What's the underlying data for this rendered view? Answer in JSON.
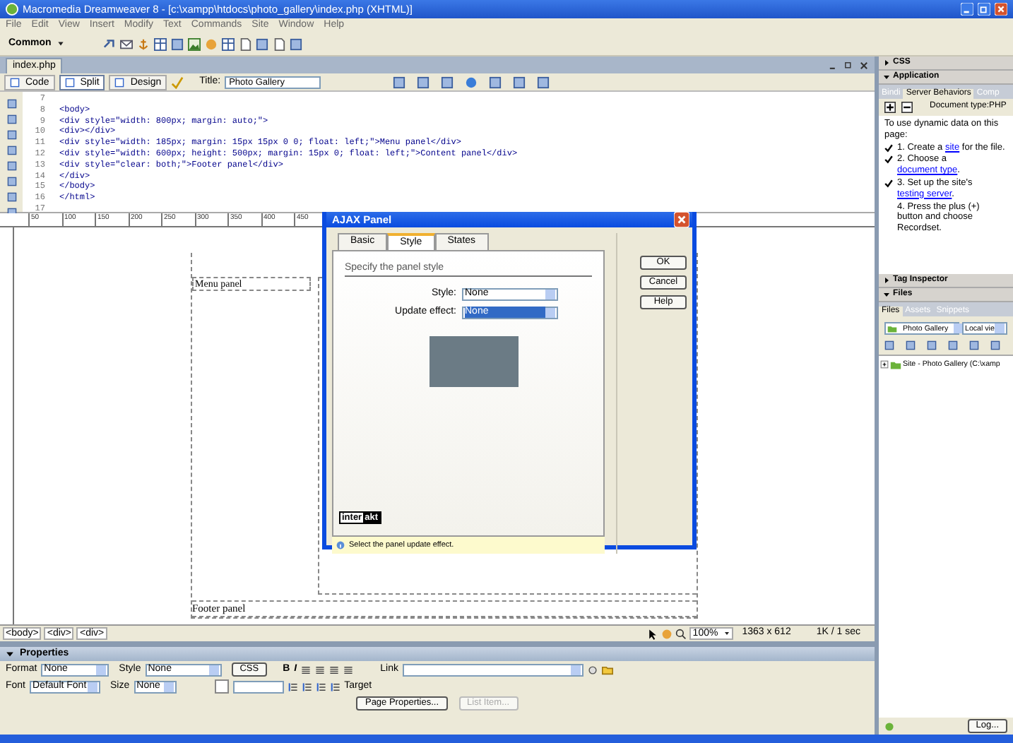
{
  "window": {
    "title": "Macromedia Dreamweaver 8 - [c:\\xampp\\htdocs\\photo_gallery\\index.php (XHTML)]"
  },
  "menu": [
    "File",
    "Edit",
    "View",
    "Insert",
    "Modify",
    "Text",
    "Commands",
    "Site",
    "Window",
    "Help"
  ],
  "insert_bar": {
    "category": "Common"
  },
  "document": {
    "tab": "index.php",
    "views": [
      {
        "label": "Code",
        "selected": false
      },
      {
        "label": "Split",
        "selected": true
      },
      {
        "label": "Design",
        "selected": false
      }
    ],
    "title_label": "Title:",
    "title_value": "Photo Gallery",
    "code_lines": [
      {
        "number": "7"
      },
      {
        "number": "8",
        "text": "<body>"
      },
      {
        "number": "9",
        "text": "<div style=\"width: 800px; margin: auto;\">"
      },
      {
        "number": "10",
        "text": "<div></div>"
      },
      {
        "number": "11",
        "text": "<div style=\"width: 185px; margin: 15px 15px 0 0; float: left;\">Menu panel</div>"
      },
      {
        "number": "12",
        "text": "<div style=\"width: 600px; height: 500px; margin: 15px 0; float: left;\">Content panel</div>"
      },
      {
        "number": "13",
        "text": "<div style=\"clear: both;\">Footer panel</div>"
      },
      {
        "number": "14",
        "text": "</div>"
      },
      {
        "number": "15",
        "text": "</body>"
      },
      {
        "number": "16",
        "text": "</html>"
      },
      {
        "number": "17"
      }
    ],
    "ruler": [
      "50",
      "100",
      "150",
      "200",
      "250",
      "300",
      "350",
      "400",
      "450"
    ],
    "menu_panel": "Menu panel",
    "footer_panel": "Footer panel",
    "tag_selector": [
      "<body>",
      "<div>",
      "<div>"
    ],
    "zoom": "100%",
    "size": "1363 x 612",
    "download": "1K / 1 sec"
  },
  "properties": {
    "title": "Properties",
    "format_label": "Format",
    "format_value": "None",
    "style_label": "Style",
    "style_value": "None",
    "css_button": "CSS",
    "bold": "B",
    "italic": "I",
    "link_label": "Link",
    "font_label": "Font",
    "font_value": "Default Font",
    "size_label": "Size",
    "size_value": "None",
    "target_label": "Target",
    "page_properties": "Page Properties...",
    "list_item": {
      "label": "List Item...",
      "disabled": true
    }
  },
  "panels": [
    {
      "title": "CSS",
      "expanded": false
    },
    {
      "title": "Application",
      "expanded": true,
      "tabs": [
        {
          "label": "Bindi",
          "selected": false
        },
        {
          "label": "Server Behaviors",
          "selected": true
        },
        {
          "label": "Comp",
          "selected": false
        }
      ],
      "document_type": "Document type:PHP",
      "intro": "To use dynamic data on this page:",
      "steps": [
        {
          "before": "1. Create a ",
          "link": "site",
          "after": " for the file.",
          "checked": true
        },
        {
          "before": "2. Choose a ",
          "link": "document type",
          "after": ".",
          "checked": true
        },
        {
          "before": "3. Set up the site's ",
          "link": "testing server",
          "after": ".",
          "checked": true
        },
        {
          "before": "4. Press the plus (+) button and choose Recordset.",
          "checked": false
        }
      ]
    },
    {
      "title": "Tag Inspector",
      "expanded": false
    },
    {
      "title": "Files",
      "expanded": true,
      "tabs": [
        {
          "label": "Files",
          "selected": true
        },
        {
          "label": "Assets",
          "selected": false
        },
        {
          "label": "Snippets",
          "selected": false
        }
      ],
      "site": "Photo Gallery",
      "view": "Local vie",
      "tree": "Site - Photo Gallery (C:\\xamp"
    }
  ],
  "log_button": "Log...",
  "dialog": {
    "title": "AJAX Panel",
    "tabs": [
      {
        "label": "Basic",
        "selected": false
      },
      {
        "label": "Style",
        "selected": true
      },
      {
        "label": "States",
        "selected": false
      }
    ],
    "section": "Specify the panel style",
    "style_label": "Style:",
    "style_value": "None",
    "effect_label": "Update effect:",
    "effect_value": "None",
    "logo_a": "inter",
    "logo_b": "akt",
    "hint": "Select the panel update effect.",
    "buttons": [
      "OK",
      "Cancel",
      "Help"
    ]
  }
}
